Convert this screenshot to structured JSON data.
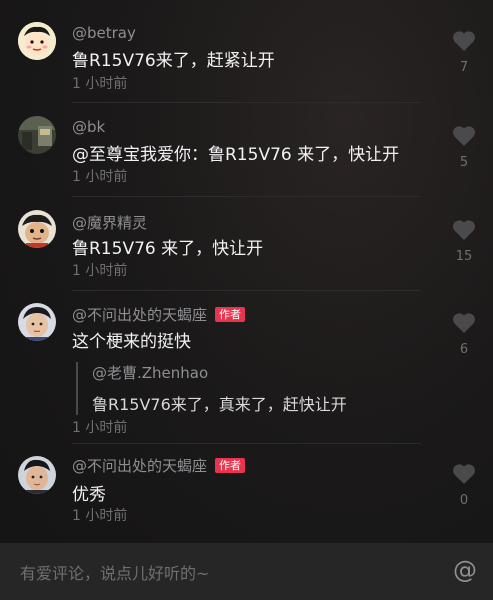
{
  "comments": [
    {
      "username": "@betray",
      "text": "鲁R15V76来了，赶紧让开",
      "time": "1 小时前",
      "likes": "7"
    },
    {
      "username": "@bk",
      "text": "@至尊宝我爱你：鲁R15V76 来了，快让开",
      "time": "1 小时前",
      "likes": "5"
    },
    {
      "username": "@魔界精灵",
      "text": "鲁R15V76 来了，快让开",
      "time": "1 小时前",
      "likes": "15"
    },
    {
      "username": "@不问出处的天蝎座",
      "badge": "作者",
      "text": "这个梗来的挺快",
      "quote_author": "@老曹.Zhenhao",
      "quote_text": "鲁R15V76来了，真来了，赶快让开",
      "time": "1 小时前",
      "likes": "6"
    },
    {
      "username": "@不问出处的天蝎座",
      "badge": "作者",
      "text": "优秀",
      "time": "1 小时前",
      "likes": "0"
    }
  ],
  "input": {
    "placeholder": "有爱评论，说点儿好听的~",
    "at_symbol": "@"
  },
  "colors": {
    "author_badge": "#e8344e",
    "background": "#161616",
    "input_bar": "#262626"
  },
  "icons": [
    "heart-icon",
    "at-icon"
  ]
}
